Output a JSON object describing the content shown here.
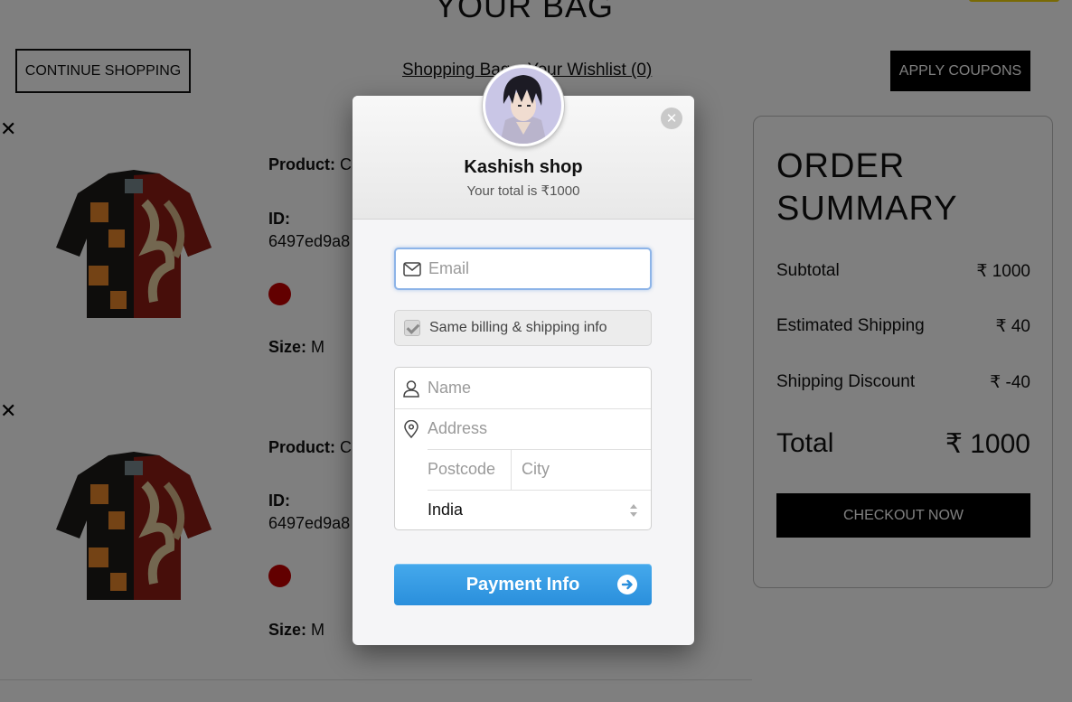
{
  "page": {
    "title": "YOUR BAG",
    "continue_label": "CONTINUE SHOPPING",
    "shopping_bag_label": "Shopping Bag",
    "wishlist_label": "Your Wishlist (0)",
    "apply_coupons_label": "APPLY COUPONS"
  },
  "products": [
    {
      "product_label": "Product:",
      "product_value": "C",
      "id_label": "ID:",
      "id_value": "6497ed9a8",
      "size_label": "Size:",
      "size_value": "M",
      "color": "#c40000"
    },
    {
      "product_label": "Product:",
      "product_value": "C",
      "id_label": "ID:",
      "id_value": "6497ed9a8",
      "size_label": "Size:",
      "size_value": "M",
      "color": "#c40000"
    }
  ],
  "summary": {
    "title_line1": "ORDER",
    "title_line2": "SUMMARY",
    "rows": [
      {
        "label": "Subtotal",
        "value": "₹ 1000"
      },
      {
        "label": "Estimated Shipping",
        "value": "₹ 40"
      },
      {
        "label": "Shipping Discount",
        "value": "₹ -40"
      }
    ],
    "total_label": "Total",
    "total_value": "₹ 1000",
    "checkout_label": "CHECKOUT NOW"
  },
  "modal": {
    "shop_name": "Kashish shop",
    "total_text": "Your total is ₹1000",
    "email_placeholder": "Email",
    "billing_label": "Same billing & shipping info",
    "name_placeholder": "Name",
    "address_placeholder": "Address",
    "postcode_placeholder": "Postcode",
    "city_placeholder": "City",
    "country": "India",
    "pay_label": "Payment Info",
    "accent_color": "#2a8fdc"
  }
}
